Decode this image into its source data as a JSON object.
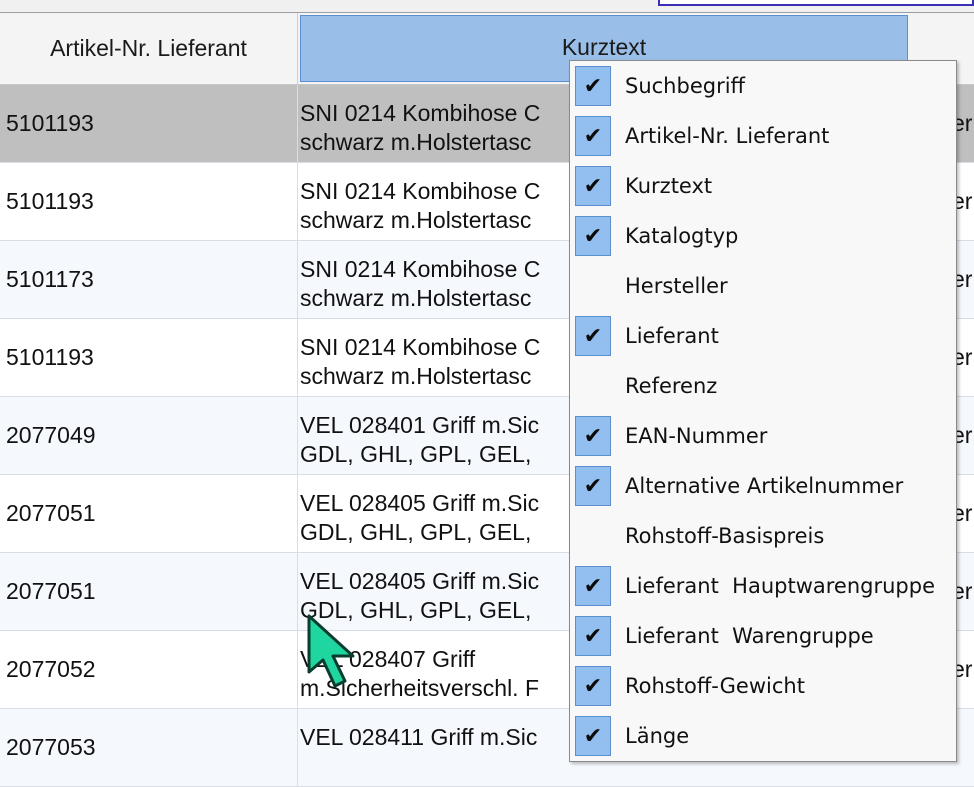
{
  "header": {
    "col_artnr": "Artikel-Nr. Lieferant",
    "col_kurztext": "Kurztext"
  },
  "rows": [
    {
      "artnr": "5101193",
      "kurz1": "SNI 0214 Kombihose C",
      "kurz2": "schwarz m.Holstertasc",
      "extra": "er",
      "selected": true
    },
    {
      "artnr": "5101193",
      "kurz1": "SNI 0214 Kombihose C",
      "kurz2": "schwarz m.Holstertasc",
      "extra": "er"
    },
    {
      "artnr": "5101173",
      "kurz1": "SNI 0214 Kombihose C",
      "kurz2": "schwarz m.Holstertasc",
      "extra": "er"
    },
    {
      "artnr": "5101193",
      "kurz1": "SNI 0214 Kombihose C",
      "kurz2": "schwarz m.Holstertasc",
      "extra": "er"
    },
    {
      "artnr": "2077049",
      "kurz1": "VEL 028401 Griff m.Sic",
      "kurz2": "GDL, GHL, GPL, GEL,",
      "extra": "er"
    },
    {
      "artnr": "2077051",
      "kurz1": "VEL 028405 Griff m.Sic",
      "kurz2": "GDL, GHL, GPL, GEL,",
      "extra": "er"
    },
    {
      "artnr": "2077051",
      "kurz1": "VEL 028405 Griff m.Sic",
      "kurz2": "GDL, GHL, GPL, GEL,",
      "extra": "er"
    },
    {
      "artnr": "2077052",
      "kurz1": "VEL 028407 Griff",
      "kurz2": "m.Sicherheitsverschl. F",
      "extra": "er"
    },
    {
      "artnr": "2077053",
      "kurz1": "VEL 028411 Griff m.Sic",
      "kurz2": "",
      "extra": ""
    }
  ],
  "column_menu": {
    "items": [
      {
        "label": "Suchbegriff",
        "checked": true
      },
      {
        "label": "Artikel-Nr. Lieferant",
        "checked": true
      },
      {
        "label": "Kurztext",
        "checked": true
      },
      {
        "label": "Katalogtyp",
        "checked": true
      },
      {
        "label": "Hersteller",
        "checked": false
      },
      {
        "label": "Lieferant",
        "checked": true
      },
      {
        "label": "Referenz",
        "checked": false
      },
      {
        "label": "EAN-Nummer",
        "checked": true
      },
      {
        "label": "Alternative Artikelnummer",
        "checked": true
      },
      {
        "label": "Rohstoff-Basispreis",
        "checked": false
      },
      {
        "label": "Lieferant  Hauptwarengruppe",
        "checked": true
      },
      {
        "label": "Lieferant  Warengruppe",
        "checked": true
      },
      {
        "label": "Rohstoff-Gewicht",
        "checked": true
      },
      {
        "label": "Länge",
        "checked": true
      }
    ],
    "check_glyph": "✔"
  },
  "cursor_icon": "mouse-pointer-icon",
  "colors": {
    "header_selected_bg": "#99bfe8",
    "row_selected_bg": "#bfbfbf",
    "check_bg": "#93bff0",
    "cursor": "#1fd6a0"
  }
}
